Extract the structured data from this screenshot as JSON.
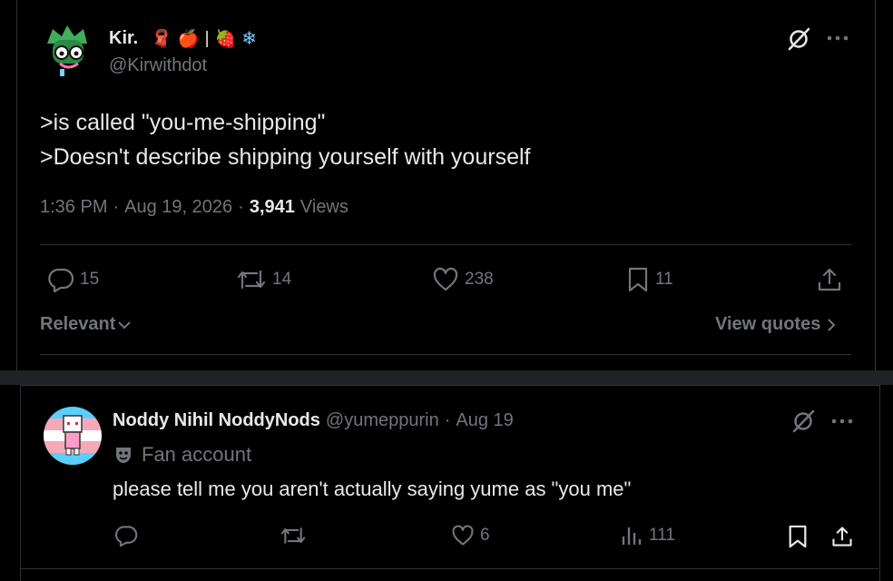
{
  "main_post": {
    "display_name": "Kir.",
    "name_emoji": [
      "🧣",
      "🍎",
      "|",
      "🍓",
      "❄"
    ],
    "handle": "@Kirwithdot",
    "text_lines": [
      ">is called \"you-me-shipping\"",
      ">Doesn't describe shipping yourself with yourself"
    ],
    "time": "1:36 PM",
    "date": "Aug 19, 2026",
    "views_count": "3,941",
    "views_label": "Views",
    "replies": "15",
    "reposts": "14",
    "likes": "238",
    "bookmarks": "11",
    "sort_label": "Relevant",
    "view_quotes": "View quotes"
  },
  "reply": {
    "display_name": "Noddy Nihil NoddyNods",
    "handle": "@yumeppurin",
    "date": "Aug 19",
    "label": "Fan account",
    "text": "please tell me you aren't actually saying yume as \"you me\"",
    "likes": "6",
    "views": "111"
  },
  "colors": {
    "background": "#000000",
    "text": "#e7e9ea",
    "secondary": "#71767b",
    "border": "#2f3336",
    "divider": "#1f2327"
  },
  "icons": [
    "grok-icon",
    "more-icon",
    "reply-icon",
    "repost-icon",
    "like-icon",
    "bookmark-icon",
    "share-icon",
    "views-icon",
    "chevron-down-icon",
    "chevron-right-icon",
    "fan-mask-icon"
  ]
}
